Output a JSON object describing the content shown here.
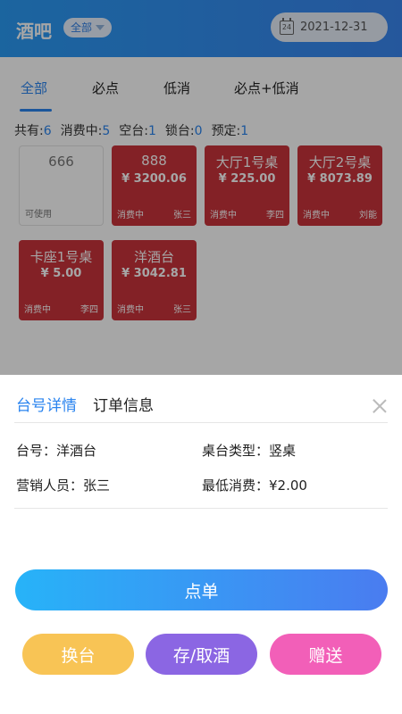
{
  "header": {
    "title": "酒吧",
    "filter_label": "全部",
    "date": "2021-12-31",
    "calendar_day": "24"
  },
  "tabs": [
    "全部",
    "必点",
    "低消",
    "必点+低消"
  ],
  "stats": {
    "total_label": "共有:",
    "total": "6",
    "consuming_label": "消费中:",
    "consuming": "5",
    "empty_label": "空台:",
    "empty": "1",
    "locked_label": "锁台:",
    "locked": "0",
    "reserved_label": "预定:",
    "reserved": "1"
  },
  "tables": [
    {
      "name": "666",
      "amount": "",
      "status": "可使用",
      "person": ""
    },
    {
      "name": "888",
      "amount": "¥ 3200.06",
      "status": "消费中",
      "person": "张三"
    },
    {
      "name": "大厅1号桌",
      "amount": "¥ 225.00",
      "status": "消费中",
      "person": "李四"
    },
    {
      "name": "大厅2号桌",
      "amount": "¥ 8073.89",
      "status": "消费中",
      "person": "刘能"
    },
    {
      "name": "卡座1号桌",
      "amount": "¥ 5.00",
      "status": "消费中",
      "person": "李四"
    },
    {
      "name": "洋酒台",
      "amount": "¥ 3042.81",
      "status": "消费中",
      "person": "张三"
    }
  ],
  "sheet": {
    "tab_details": "台号详情",
    "tab_order": "订单信息",
    "table_no_label": "台号：",
    "table_no": "洋酒台",
    "table_type_label": "桌台类型：",
    "table_type": "竖桌",
    "sales_label": "营销人员：",
    "sales": "张三",
    "min_spend_label": "最低消费：",
    "min_spend": "¥2.00"
  },
  "buttons": {
    "order": "点单",
    "change_table": "换台",
    "store_wine": "存/取酒",
    "gift": "赠送"
  },
  "colors": {
    "accent": "#2a84ef",
    "occupied": "#c9333b",
    "btn_yellow": "#f8c455",
    "btn_purple": "#8b66e3",
    "btn_pink": "#f25fb8"
  }
}
